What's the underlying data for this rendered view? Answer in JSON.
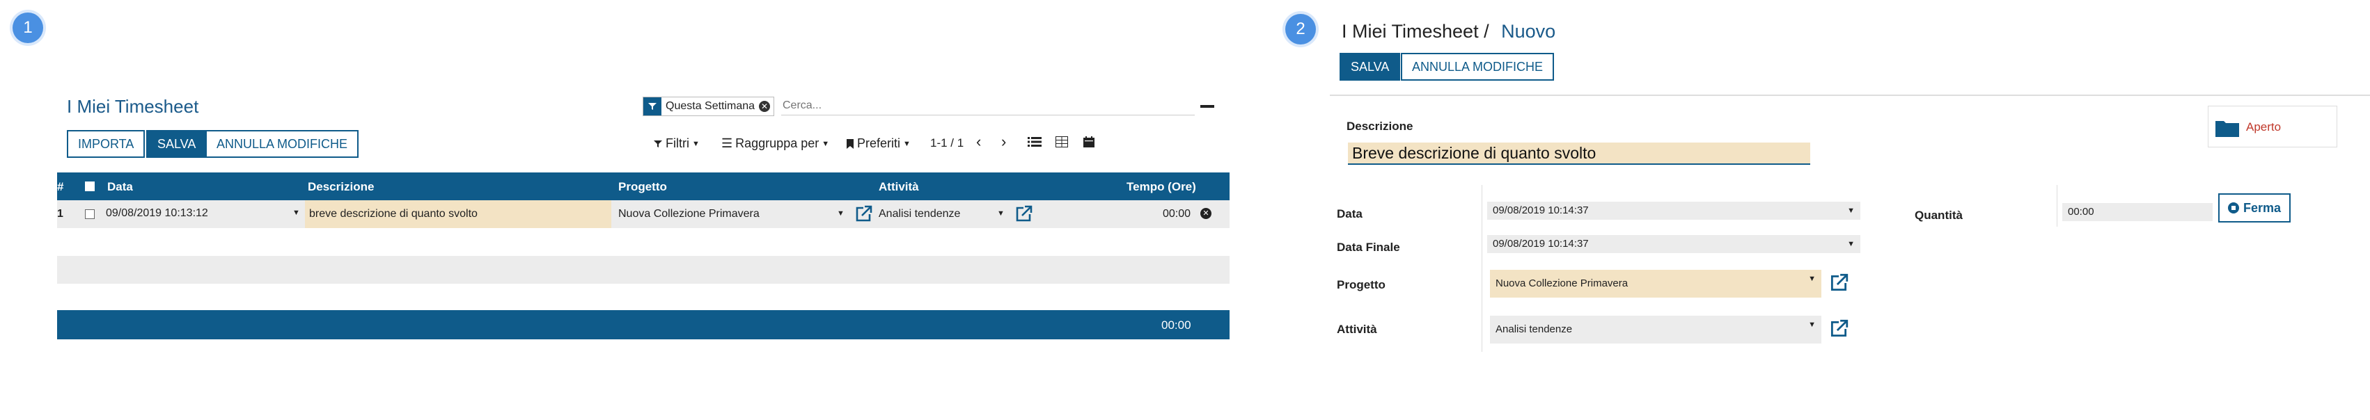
{
  "steps": [
    "1",
    "2"
  ],
  "left": {
    "title": "I Miei Timesheet",
    "buttons": {
      "import": "IMPORTA",
      "save": "SALVA",
      "discard": "ANNULLA MODIFICHE"
    },
    "search": {
      "facet": "Questa Settimana",
      "placeholder": "Cerca..."
    },
    "toolbar": {
      "filters": "Filtri",
      "groupby": "Raggruppa per",
      "favorites": "Preferiti",
      "pager": "1-1 / 1"
    },
    "columns": {
      "num": "#",
      "date": "Data",
      "desc": "Descrizione",
      "project": "Progetto",
      "activity": "Attività",
      "time": "Tempo (Ore)"
    },
    "rows": [
      {
        "num": "1",
        "date": "09/08/2019 10:13:12",
        "desc": "breve descrizione di quanto svolto",
        "project": "Nuova Collezione Primavera",
        "activity": "Analisi tendenze",
        "time": "00:00"
      }
    ],
    "total": "00:00"
  },
  "right": {
    "breadcrumb": {
      "parent": "I Miei Timesheet",
      "sep": "/",
      "current": "Nuovo"
    },
    "buttons": {
      "save": "SALVA",
      "discard": "ANNULLA MODIFICHE"
    },
    "status": "Aperto",
    "desc_label": "Descrizione",
    "desc_value": "Breve descrizione di quanto svolto",
    "fields": {
      "date_label": "Data",
      "date_value": "09/08/2019 10:14:37",
      "end_label": "Data Finale",
      "end_value": "09/08/2019 10:14:37",
      "project_label": "Progetto",
      "project_value": "Nuova Collezione Primavera",
      "activity_label": "Attività",
      "activity_value": "Analisi tendenze",
      "qty_label": "Quantità",
      "qty_value": "00:00"
    },
    "stop_button": "Ferma"
  },
  "colors": {
    "primary": "#0f5b8a",
    "highlight": "#f3e3c4",
    "status": "#c0392b",
    "badge": "#4a90e2"
  }
}
